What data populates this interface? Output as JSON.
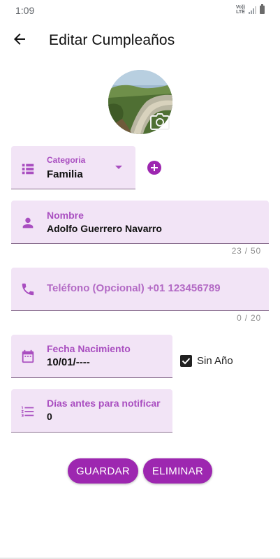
{
  "status_bar": {
    "time": "1:09",
    "network_top": "Vo))",
    "network_bottom": "LTE"
  },
  "app_bar": {
    "title": "Editar Cumpleaños",
    "back_icon": "arrow-left-icon"
  },
  "avatar": {
    "camera_icon": "camera-icon"
  },
  "category": {
    "label": "Categoria",
    "value": "Familia",
    "icon": "list-icon"
  },
  "name": {
    "label": "Nombre",
    "value": "Adolfo Guerrero Navarro",
    "counter": "23 / 50",
    "icon": "person-icon"
  },
  "phone": {
    "placeholder": "Teléfono (Opcional) +01 123456789",
    "counter": "0 / 20",
    "icon": "phone-icon"
  },
  "birth_date": {
    "label": "Fecha Nacimiento",
    "value": "10/01/----",
    "icon": "calendar-icon"
  },
  "no_year": {
    "label": "Sin Año",
    "checked": true
  },
  "notify_days": {
    "label": "Días antes para notificar",
    "value": "0",
    "icon": "numbered-list-icon"
  },
  "actions": {
    "save_label": "GUARDAR",
    "delete_label": "ELIMINAR"
  },
  "colors": {
    "accent": "#9d27b0",
    "field_bg": "#f2e4f6",
    "label": "#a94ec0"
  }
}
